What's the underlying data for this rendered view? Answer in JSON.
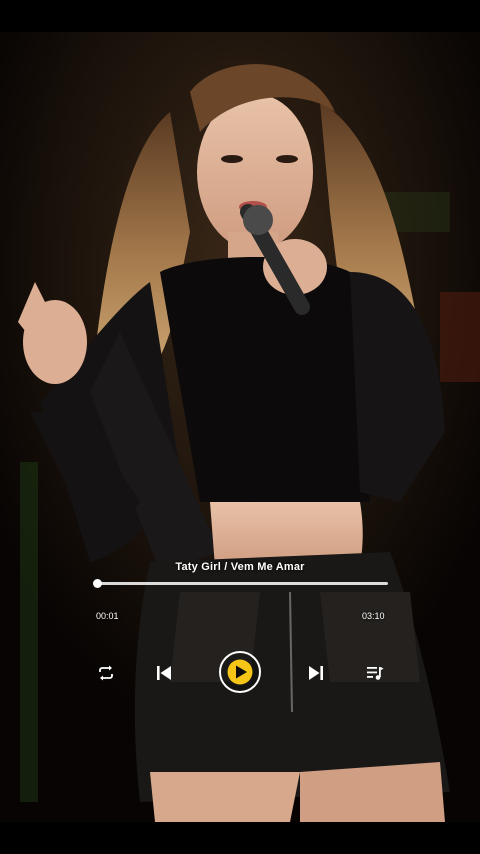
{
  "player": {
    "title": "Taty Girl / Vem Me Amar",
    "current_time": "00:01",
    "total_time": "03:10",
    "progress_fraction": 0.0,
    "accent_color": "#f5c518"
  },
  "controls": {
    "repeat_icon": "repeat-icon",
    "previous_icon": "skip-previous-icon",
    "play_icon": "play-icon",
    "next_icon": "skip-next-icon",
    "playlist_icon": "playlist-icon"
  }
}
